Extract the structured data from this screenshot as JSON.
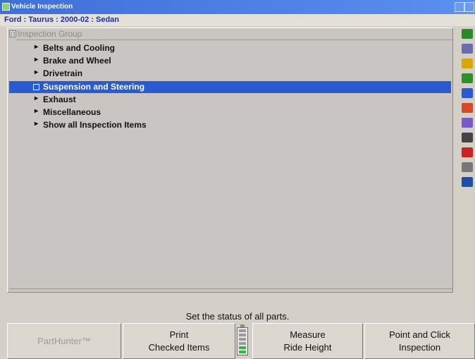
{
  "window": {
    "title": "Vehicle Inspection"
  },
  "vehicle": {
    "label": "Ford : Taurus : 2000-02 : Sedan"
  },
  "tree": {
    "group_expander": "⊟",
    "group_label": "Inspection Group",
    "items": [
      {
        "label": "Belts and Cooling",
        "bullet": "▸"
      },
      {
        "label": "Brake and Wheel",
        "bullet": "▸"
      },
      {
        "label": "Drivetrain",
        "bullet": "▸"
      },
      {
        "label": "Suspension and Steering",
        "bullet": "▫"
      },
      {
        "label": "Exhaust",
        "bullet": "▸"
      },
      {
        "label": "Miscellaneous",
        "bullet": "▸"
      },
      {
        "label": "Show all Inspection Items",
        "bullet": "▸"
      }
    ],
    "selected_item": "Suspension and Steering"
  },
  "side_toolbar": {
    "icons": [
      "help-icon",
      "vehicle-specs-icon",
      "tire-icon",
      "alignment-readings-icon",
      "wheel-icon",
      "camber-chart-icon",
      "ride-height-icon",
      "inspection-report-icon",
      "warning-icon",
      "tools-icon",
      "globe-icon"
    ],
    "colors": [
      "#2a8a2a",
      "#6b6bb0",
      "#d9a800",
      "#2f8f2f",
      "#2a5acf",
      "#d64a2a",
      "#7a5ac8",
      "#444444",
      "#cc2222",
      "#777777",
      "#1d4fa8"
    ]
  },
  "status": {
    "message": "Set the status of all parts."
  },
  "buttons": {
    "parthunter": "PartHunter™",
    "print_line1": "Print",
    "print_line2": "Checked Items",
    "ride_line1": "Measure",
    "ride_line2": "Ride Height",
    "point_line1": "Point and Click",
    "point_line2": "Inspection"
  },
  "battery": {
    "charge_fraction": 0.33
  }
}
